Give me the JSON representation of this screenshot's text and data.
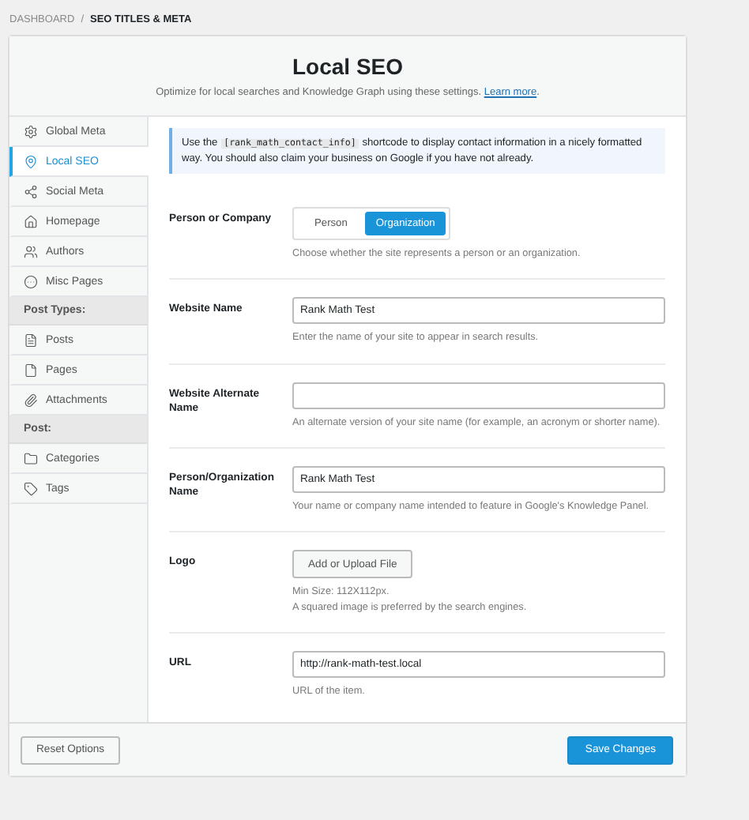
{
  "breadcrumb_separator": "/",
  "breadcrumb": [
    {
      "label": "DASHBOARD",
      "current": false
    },
    {
      "label": "SEO TITLES & META",
      "current": true
    }
  ],
  "header": {
    "title": "Local SEO",
    "subtitle": "Optimize for local searches and Knowledge Graph using these settings.",
    "link": "Learn more",
    "link_after": "."
  },
  "sidebar": [
    {
      "kind": "item",
      "label": "Global Meta",
      "selected": false
    },
    {
      "kind": "item",
      "label": "Local SEO",
      "selected": true
    },
    {
      "kind": "item",
      "label": "Social Meta",
      "selected": false
    },
    {
      "kind": "item",
      "label": "Homepage",
      "selected": false
    },
    {
      "kind": "item",
      "label": "Authors",
      "selected": false
    },
    {
      "kind": "item",
      "label": "Misc Pages",
      "selected": false
    },
    {
      "kind": "heading",
      "label": "Post Types:"
    },
    {
      "kind": "item",
      "label": "Posts",
      "selected": false
    },
    {
      "kind": "item",
      "label": "Pages",
      "selected": false
    },
    {
      "kind": "item",
      "label": "Attachments",
      "selected": false
    },
    {
      "kind": "heading",
      "label": "Post:"
    },
    {
      "kind": "item",
      "label": "Categories",
      "selected": false
    },
    {
      "kind": "item",
      "label": "Tags",
      "selected": false
    }
  ],
  "notice": {
    "before": "Use the",
    "code": "[rank_math_contact_info]",
    "after": "shortcode to display contact information in a nicely formatted way. You should also claim your business on Google if you have not already."
  },
  "fields": [
    {
      "kind": "toggle",
      "label": "Person or Company",
      "options": [
        {
          "label": "Person",
          "selected": false
        },
        {
          "label": "Organization",
          "selected": true
        }
      ],
      "help": [
        "Choose whether the site represents a person or an organization."
      ]
    },
    {
      "kind": "text",
      "label": "Website Name",
      "value": "Rank Math Test",
      "help": [
        "Enter the name of your site to appear in search results."
      ]
    },
    {
      "kind": "text",
      "label": "Website Alternate Name",
      "help": [
        "An alternate version of your site name (for example, an acronym or shorter name)."
      ]
    },
    {
      "kind": "text",
      "label": "Person/Organization Name",
      "value": "Rank Math Test",
      "help": [
        "Your name or company name intended to feature in Google's Knowledge Panel."
      ]
    },
    {
      "kind": "upload",
      "label": "Logo",
      "button": "Add or Upload File",
      "help": [
        "Min Size: 112X112px.",
        "A squared image is preferred by the search engines."
      ]
    },
    {
      "kind": "text",
      "label": "URL",
      "value": "http://rank-math-test.local",
      "help": [
        "URL of the item."
      ]
    }
  ],
  "footer": {
    "reset": "Reset Options",
    "save": "Save Changes"
  }
}
